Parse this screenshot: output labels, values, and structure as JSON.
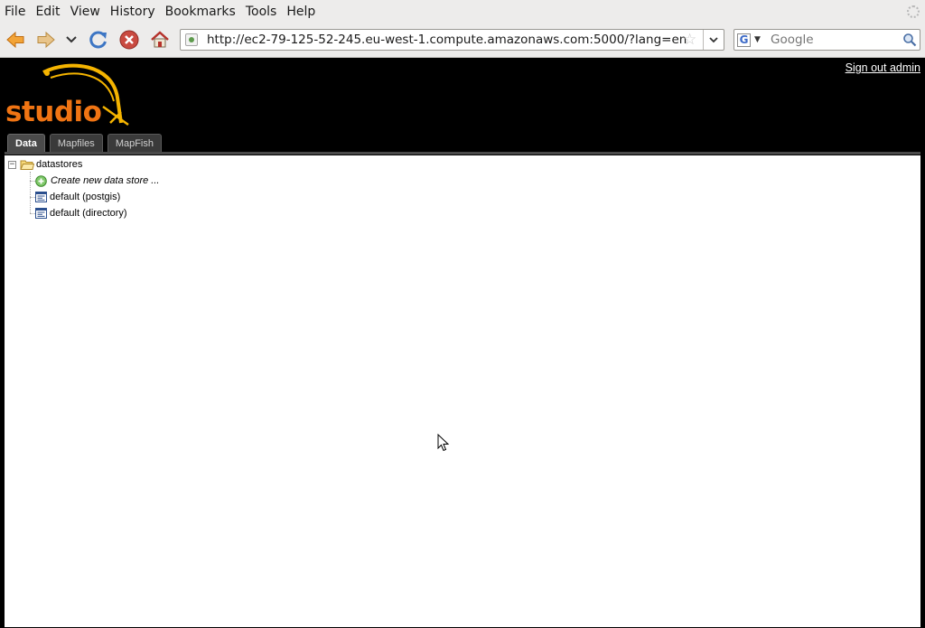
{
  "browser": {
    "menu": [
      {
        "label": "File"
      },
      {
        "label": "Edit"
      },
      {
        "label": "View"
      },
      {
        "label": "History"
      },
      {
        "label": "Bookmarks"
      },
      {
        "label": "Tools"
      },
      {
        "label": "Help"
      }
    ],
    "url": "http://ec2-79-125-52-245.eu-west-1.compute.amazonaws.com:5000/?lang=en",
    "search": {
      "engine_icon": "google-icon",
      "placeholder": "Google"
    }
  },
  "app": {
    "logo_text": "studio",
    "signout_label": "Sign out admin",
    "tabs": [
      {
        "label": "Data",
        "active": true
      },
      {
        "label": "Mapfiles",
        "active": false
      },
      {
        "label": "MapFish",
        "active": false
      }
    ],
    "tree": {
      "root_label": "datastores",
      "create_label": "Create new data store ...",
      "items": [
        {
          "label": "default (postgis)"
        },
        {
          "label": "default (directory)"
        }
      ]
    }
  },
  "colors": {
    "brand_orange": "#f07413",
    "logo_arc": "#f5b400",
    "background": "#000000"
  }
}
